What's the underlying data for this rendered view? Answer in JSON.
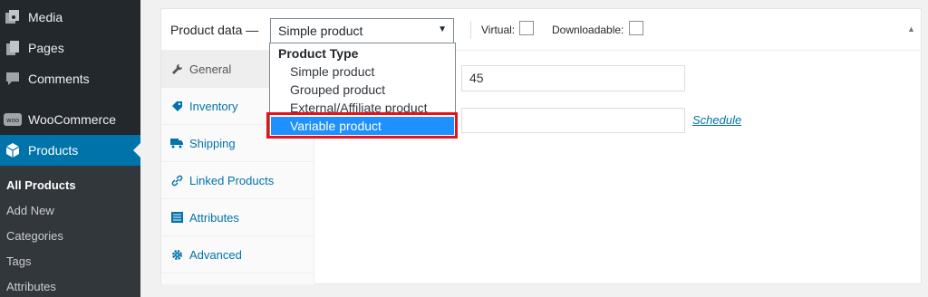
{
  "sidebar": {
    "items": [
      {
        "label": "Media",
        "icon": "media-icon"
      },
      {
        "label": "Pages",
        "icon": "pages-icon"
      },
      {
        "label": "Comments",
        "icon": "comments-icon"
      },
      {
        "label": "WooCommerce",
        "icon": "woocommerce-icon"
      },
      {
        "label": "Products",
        "icon": "products-icon"
      }
    ],
    "submenu": [
      "All Products",
      "Add New",
      "Categories",
      "Tags",
      "Attributes"
    ]
  },
  "panel": {
    "title": "Product data —",
    "product_type_value": "Simple product",
    "virtual_label": "Virtual:",
    "downloadable_label": "Downloadable:",
    "tabs": [
      {
        "label": "General",
        "icon": "wrench-icon"
      },
      {
        "label": "Inventory",
        "icon": "tag-icon"
      },
      {
        "label": "Shipping",
        "icon": "truck-icon"
      },
      {
        "label": "Linked Products",
        "icon": "link-icon"
      },
      {
        "label": "Attributes",
        "icon": "list-icon"
      },
      {
        "label": "Advanced",
        "icon": "gear-icon"
      }
    ],
    "regular_price_value": "45",
    "sale_price_value": "",
    "schedule_label": "Schedule"
  },
  "dropdown": {
    "group_label": "Product Type",
    "options": [
      "Simple product",
      "Grouped product",
      "External/Affiliate product",
      "Variable product"
    ],
    "highlighted": "Variable product"
  },
  "colors": {
    "sidebar_bg": "#23282d",
    "active_blue": "#0073aa",
    "highlight_blue": "#1e90ff",
    "annotation_red": "#e3121c"
  }
}
